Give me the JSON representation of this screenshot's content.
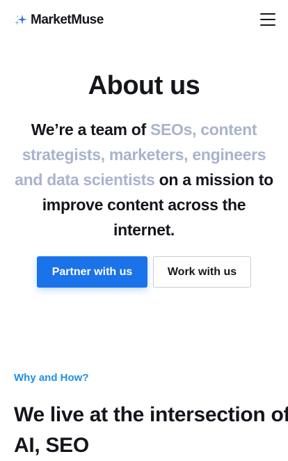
{
  "header": {
    "logo_text": "MarketMuse",
    "logo_icon": "sparkle-icon",
    "menu_icon": "hamburger-icon"
  },
  "hero": {
    "title": "About us",
    "text_before": "We’re a team of ",
    "text_highlight": "SEOs, content strategists, marketers, engineers and data scientists",
    "text_after": " on a mission to improve content across the internet.",
    "highlight_color": "#a9b3cd"
  },
  "buttons": {
    "primary_label": "Partner with us",
    "secondary_label": "Work with us",
    "primary_color": "#1a73e8"
  },
  "section": {
    "eyebrow": "Why and How?",
    "eyebrow_color": "#1e8fe6",
    "title": "We live at the intersection of AI, SEO"
  }
}
